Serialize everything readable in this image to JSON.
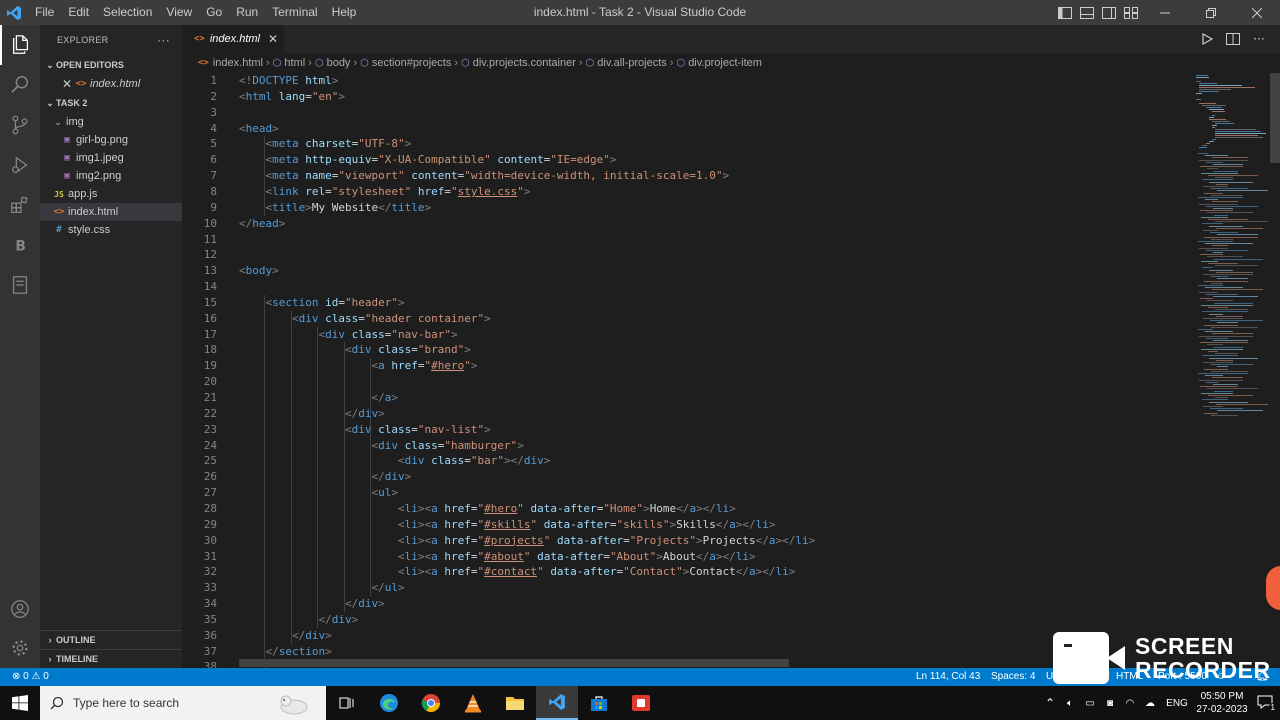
{
  "titlebar": {
    "menus": [
      "File",
      "Edit",
      "Selection",
      "View",
      "Go",
      "Run",
      "Terminal",
      "Help"
    ],
    "window_title": "index.html - Task 2 - Visual Studio Code"
  },
  "sidebar": {
    "explorer_title": "EXPLORER",
    "more": "···",
    "open_editors_title": "OPEN EDITORS",
    "open_editors": [
      {
        "name": "index.html"
      }
    ],
    "workspace_title": "TASK 2",
    "tree": [
      {
        "label": "img",
        "type": "folder",
        "depth": 0
      },
      {
        "label": "girl-bg.png",
        "type": "image",
        "depth": 1
      },
      {
        "label": "img1.jpeg",
        "type": "image",
        "depth": 1
      },
      {
        "label": "img2.png",
        "type": "image",
        "depth": 1
      },
      {
        "label": "app.js",
        "type": "js",
        "depth": 0
      },
      {
        "label": "index.html",
        "type": "html",
        "depth": 0,
        "selected": true
      },
      {
        "label": "style.css",
        "type": "css",
        "depth": 0
      }
    ],
    "outline_title": "OUTLINE",
    "timeline_title": "TIMELINE"
  },
  "tabs": [
    {
      "label": "index.html",
      "active": true
    }
  ],
  "breadcrumb": [
    "index.html",
    "html",
    "body",
    "section#projects",
    "div.projects.container",
    "div.all-projects",
    "div.project-item"
  ],
  "code_lines": [
    "<!DOCTYPE html>",
    "<html lang=\"en\">",
    "",
    "<head>",
    "    <meta charset=\"UTF-8\">",
    "    <meta http-equiv=\"X-UA-Compatible\" content=\"IE=edge\">",
    "    <meta name=\"viewport\" content=\"width=device-width, initial-scale=1.0\">",
    "    <link rel=\"stylesheet\" href=\"style.css\">",
    "    <title>My Website</title>",
    "</head>",
    "",
    "",
    "<body>",
    "",
    "    <section id=\"header\">",
    "        <div class=\"header container\">",
    "            <div class=\"nav-bar\">",
    "                <div class=\"brand\">",
    "                    <a href=\"#hero\">",
    "",
    "                    </a>",
    "                </div>",
    "                <div class=\"nav-list\">",
    "                    <div class=\"hamburger\">",
    "                        <div class=\"bar\"></div>",
    "                    </div>",
    "                    <ul>",
    "                        <li><a href=\"#hero\" data-after=\"Home\">Home</a></li>",
    "                        <li><a href=\"#skills\" data-after=\"skills\">Skills</a></li>",
    "                        <li><a href=\"#projects\" data-after=\"Projects\">Projects</a></li>",
    "                        <li><a href=\"#about\" data-after=\"About\">About</a></li>",
    "                        <li><a href=\"#contact\" data-after=\"Contact\">Contact</a></li>",
    "                    </ul>",
    "                </div>",
    "            </div>",
    "        </div>",
    "    </section>",
    ""
  ],
  "statusbar": {
    "problems": "⊗ 0 ⚠ 0",
    "cursor": "Ln 114, Col 43",
    "spaces": "Spaces: 4",
    "encoding": "U",
    "language": "HTML",
    "port": "Port : 5500"
  },
  "taskbar": {
    "search_placeholder": "Type here to search",
    "lang": "ENG",
    "time": "05:50 PM",
    "date": "27-02-2023",
    "notification_count": "1"
  },
  "overlay": {
    "recorder_line1": "SCREEN",
    "recorder_line2": "RECORDER"
  },
  "colors": {
    "accent": "#007acc",
    "tag": "#569cd6",
    "attr": "#9cdcfe",
    "string": "#ce9178",
    "bracket": "#808080"
  }
}
